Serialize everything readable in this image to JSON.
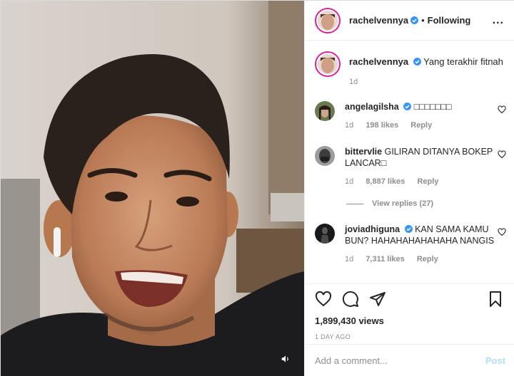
{
  "header": {
    "username": "rachelvennya",
    "separator": "•",
    "follow_status": "Following",
    "more": "..."
  },
  "caption": {
    "username": "rachelvennya",
    "text": "Yang terakhir fitnah",
    "time": "1d"
  },
  "comments": [
    {
      "username": "angelagilsha",
      "verified": true,
      "text": "□□□□□□□",
      "time": "1d",
      "likes": "198 likes",
      "reply": "Reply"
    },
    {
      "username": "bittervlie",
      "verified": false,
      "text": "GILIRAN DITANYA BOKEP LANCAR□",
      "time": "1d",
      "likes": "8,887 likes",
      "reply": "Reply"
    },
    {
      "username": "joviadhiguna",
      "verified": true,
      "text": "KAN SAMA KAMU BUN? HAHAHAHAHAHAHA NANGIS",
      "time": "1d",
      "likes": "7,311 likes",
      "reply": "Reply"
    }
  ],
  "view_replies": "View replies (27)",
  "stats": {
    "views": "1,899,430 views",
    "date": "1 DAY AGO"
  },
  "add_comment": {
    "placeholder": "Add a comment...",
    "post_label": "Post"
  },
  "colors": {
    "verified": "#3897f0",
    "post_disabled": "#b2dffc",
    "muted_text": "#8e8e8e"
  },
  "icons": [
    "heart-icon",
    "comment-icon",
    "share-icon",
    "bookmark-icon",
    "volume-icon",
    "verified-badge-icon"
  ]
}
